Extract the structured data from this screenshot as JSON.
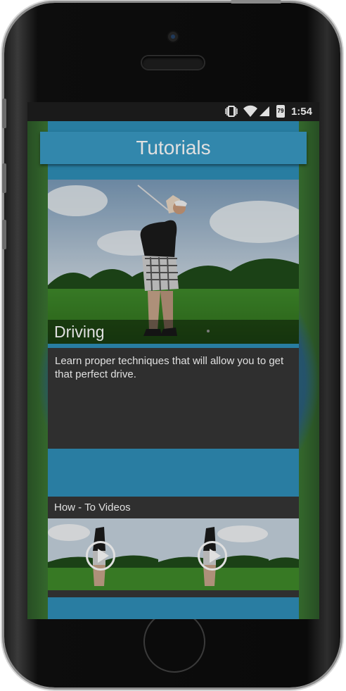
{
  "status_bar": {
    "battery_level": "79",
    "time": "1:54"
  },
  "header": {
    "title": "Tutorials"
  },
  "featured": {
    "caption": "Driving",
    "description": "Learn proper techniques that will allow you to get that perfect drive."
  },
  "videos_section": {
    "label": "How - To Videos",
    "videos": 2
  },
  "colors": {
    "accent": "#3a9ac4",
    "panel": "#363636"
  }
}
